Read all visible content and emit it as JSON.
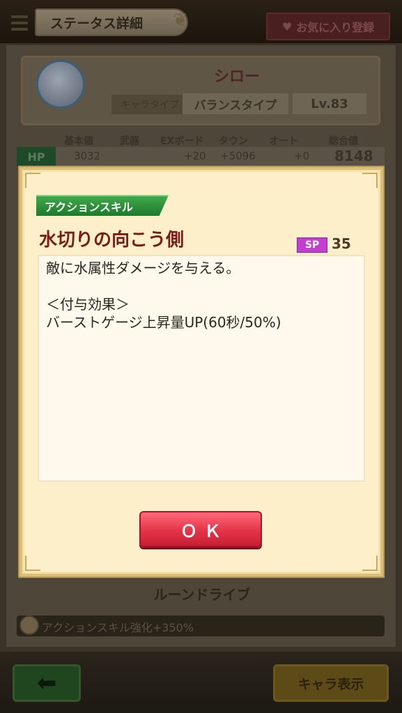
{
  "header": {
    "title": "ステータス詳細",
    "favorite_label": "お気に入り登録"
  },
  "character": {
    "name": "シロー",
    "type_label": "キャラタイプ",
    "type_value": "バランスタイプ",
    "level": "Lv.83"
  },
  "stats": {
    "headers": [
      "基本値",
      "武器",
      "EXボード",
      "タウン",
      "オート",
      "総合値"
    ],
    "hp": {
      "label": "HP",
      "base": "3032",
      "ex_board": "+20",
      "town": "+5096",
      "auto": "+0",
      "total": "8148"
    }
  },
  "rune": {
    "title": "ルーンドライブ",
    "effect": "アクションスキル強化+350%"
  },
  "footer": {
    "back_icon": "arrow-left-icon",
    "chara_label": "キャラ表示"
  },
  "dialog": {
    "tag": "アクションスキル",
    "skill_name": "水切りの向こう側",
    "sp_label": "SP",
    "sp_value": "35",
    "description": "敵に水属性ダメージを与える。\n\n＜付与効果＞\nバーストゲージ上昇量UP(60秒/50%)",
    "ok_label": "ＯＫ"
  },
  "colors": {
    "ok_button": "#e33448",
    "skill_tag": "#2a8e36",
    "skill_name": "#7a1d17",
    "sp_badge": "#c23fd0",
    "dialog_bg": "#fcefc9"
  }
}
